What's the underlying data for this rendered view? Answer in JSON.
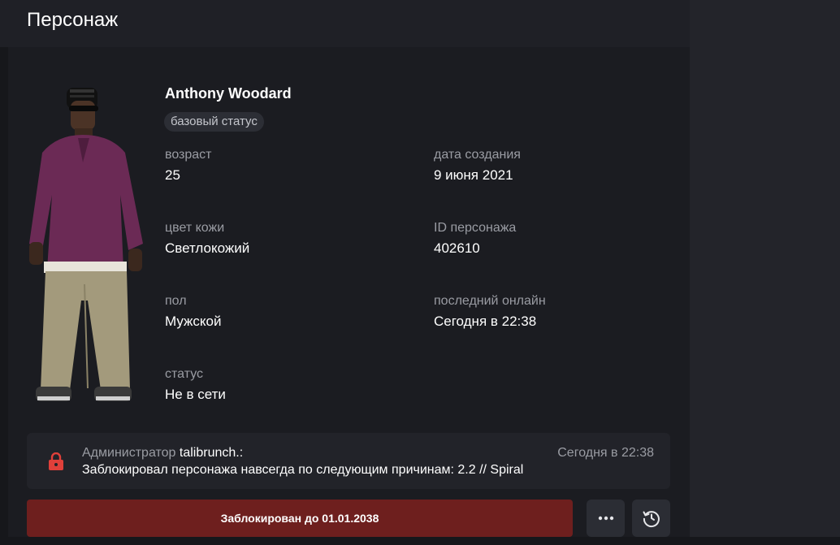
{
  "page": {
    "title": "Персонаж"
  },
  "character": {
    "name": "Anthony Woodard",
    "status_badge": "базовый статус",
    "fields": {
      "age": {
        "label": "возраст",
        "value": "25"
      },
      "created": {
        "label": "дата создания",
        "value": "9 июня 2021"
      },
      "skin": {
        "label": "цвет кожи",
        "value": "Светлокожий"
      },
      "id": {
        "label": "ID персонажа",
        "value": "402610"
      },
      "gender": {
        "label": "пол",
        "value": "Мужской"
      },
      "last_online": {
        "label": "последний онлайн",
        "value": "Сегодня в 22:38"
      },
      "status": {
        "label": "статус",
        "value": "Не в сети"
      }
    }
  },
  "log": {
    "role": "Администратор",
    "author": "talibrunch.:",
    "time": "Сегодня в 22:38",
    "text": "Заблокировал персонажа навсегда по следующим причинам: 2.2 // Spiral",
    "icon": "lock-icon",
    "icon_color": "#e0403a"
  },
  "actions": {
    "ban_label": "Заблокирован до 01.01.2038",
    "more_icon": "more-icon",
    "history_icon": "history-icon"
  },
  "colors": {
    "ban_button": "#6e1f1e",
    "panel": "#1b1c21"
  }
}
